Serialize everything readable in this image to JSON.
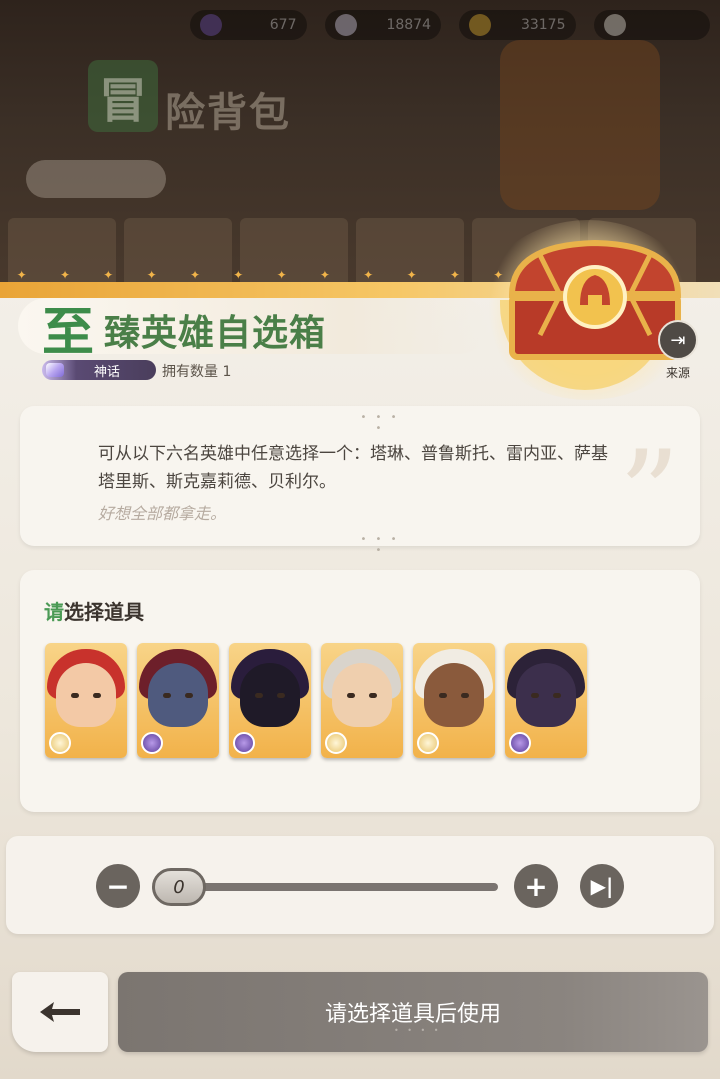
{
  "currency_bar": [
    {
      "icon": "stamina-icon",
      "value": "677",
      "color": "#6a4ea5"
    },
    {
      "icon": "diamond-icon",
      "value": "18874",
      "color": "#c9c4d6"
    },
    {
      "icon": "gold-coin-icon",
      "value": "33175",
      "color": "#d6a830"
    },
    {
      "icon": "dust-icon",
      "value": "",
      "color": "#d8d2ca"
    }
  ],
  "background": {
    "bag_badge": "冒",
    "bag_title": "险背包"
  },
  "item": {
    "title_first_char": "至",
    "title_rest": "臻英雄自选箱",
    "rarity": "神话",
    "owned_label": "拥有数量 1",
    "source_label": "来源",
    "description": "可从以下六名英雄中任意选择一个：塔琳、普鲁斯托、雷内亚、萨基塔里斯、斯克嘉莉德、贝利尔。",
    "flavor": "好想全部都拿走。"
  },
  "selection": {
    "title_accent": "请",
    "title_rest": "选择道具",
    "heroes": [
      {
        "icon": "hero-portrait-red-hair-icon",
        "faction": "light",
        "hair": "#c8322c",
        "skin": "#f3c9a6"
      },
      {
        "icon": "hero-portrait-demon-icon",
        "faction": "dark",
        "hair": "#6d1f2a",
        "skin": "#4f5a7e"
      },
      {
        "icon": "hero-portrait-hooded-dark-icon",
        "faction": "dark",
        "hair": "#2a1d3c",
        "skin": "#1f1a28"
      },
      {
        "icon": "hero-portrait-silver-hair-icon",
        "faction": "light",
        "hair": "#d9d4cc",
        "skin": "#efcfae"
      },
      {
        "icon": "hero-portrait-white-mane-icon",
        "faction": "light",
        "hair": "#f1ece3",
        "skin": "#8a5a3c"
      },
      {
        "icon": "hero-portrait-shadow-witch-icon",
        "faction": "dark",
        "hair": "#2c2238",
        "skin": "#3c2f4c"
      }
    ]
  },
  "quantity": {
    "value": "0"
  },
  "actions": {
    "use_label": "请选择道具后使用"
  }
}
